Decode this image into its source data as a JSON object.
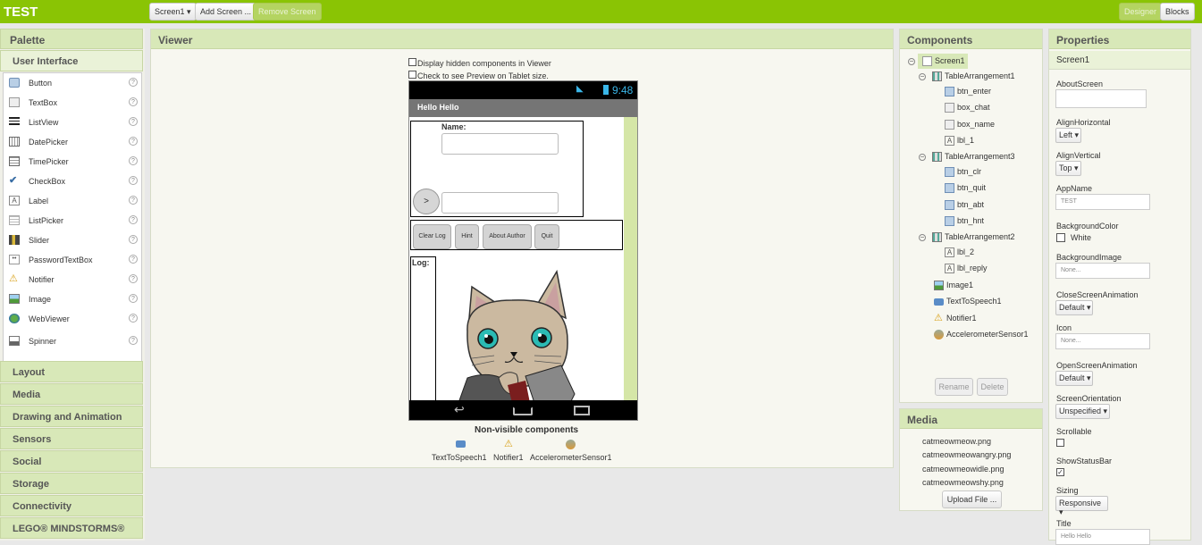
{
  "app": {
    "title": "TEST"
  },
  "toolbar": {
    "screen_select": "Screen1 ▾",
    "add_screen": "Add Screen ...",
    "remove_screen": "Remove Screen",
    "designer": "Designer",
    "blocks": "Blocks"
  },
  "palette": {
    "title": "Palette",
    "category_open": "User Interface",
    "items": [
      {
        "label": "Button",
        "icon": "button-icon"
      },
      {
        "label": "TextBox",
        "icon": "textbox-icon"
      },
      {
        "label": "ListView",
        "icon": "listview-icon"
      },
      {
        "label": "DatePicker",
        "icon": "datepicker-icon"
      },
      {
        "label": "TimePicker",
        "icon": "timepicker-icon"
      },
      {
        "label": "CheckBox",
        "icon": "checkbox-icon"
      },
      {
        "label": "Label",
        "icon": "label-icon"
      },
      {
        "label": "ListPicker",
        "icon": "listpicker-icon"
      },
      {
        "label": "Slider",
        "icon": "slider-icon"
      },
      {
        "label": "PasswordTextBox",
        "icon": "passwordtextbox-icon"
      },
      {
        "label": "Notifier",
        "icon": "notifier-icon"
      },
      {
        "label": "Image",
        "icon": "image-icon"
      },
      {
        "label": "WebViewer",
        "icon": "webviewer-icon"
      },
      {
        "label": "Spinner",
        "icon": "spinner-icon"
      }
    ],
    "categories": [
      "Layout",
      "Media",
      "Drawing and Animation",
      "Sensors",
      "Social",
      "Storage",
      "Connectivity",
      "LEGO® MINDSTORMS®"
    ]
  },
  "viewer": {
    "title": "Viewer",
    "hidden_check": "Display hidden components in Viewer",
    "tablet_check": "Check to see Preview on Tablet size.",
    "phone": {
      "time": "9:48",
      "screen_title": "Hello Hello",
      "name_label": "Name:",
      "enter_button": ">",
      "buttons": [
        "Clear Log",
        "Hint",
        "About Author",
        "Quit"
      ],
      "log_label": "Log:"
    },
    "nonvisible_title": "Non-visible components",
    "nonvisible": [
      "TextToSpeech1",
      "Notifier1",
      "AccelerometerSensor1"
    ]
  },
  "components": {
    "title": "Components",
    "tree": {
      "screen": "Screen1",
      "ta1": "TableArrangement1",
      "ta1_items": [
        "btn_enter",
        "box_chat",
        "box_name",
        "lbl_1"
      ],
      "ta3": "TableArrangement3",
      "ta3_items": [
        "btn_clr",
        "btn_quit",
        "btn_abt",
        "btn_hnt"
      ],
      "ta2": "TableArrangement2",
      "ta2_items": [
        "lbl_2",
        "lbl_reply"
      ],
      "others": [
        "Image1",
        "TextToSpeech1",
        "Notifier1",
        "AccelerometerSensor1"
      ]
    },
    "rename": "Rename",
    "delete": "Delete"
  },
  "media": {
    "title": "Media",
    "files": [
      "catmeowmeow.png",
      "catmeowmeowangry.png",
      "catmeowmeowidle.png",
      "catmeowmeowshy.png"
    ],
    "upload": "Upload File ..."
  },
  "properties": {
    "title": "Properties",
    "component": "Screen1",
    "about_screen": "AboutScreen",
    "align_h": "AlignHorizontal",
    "align_h_value": "Left ▾",
    "align_v": "AlignVertical",
    "align_v_value": "Top ▾",
    "app_name": "AppName",
    "app_name_value": "TEST",
    "bg_color": "BackgroundColor",
    "bg_color_value": "White",
    "bg_image": "BackgroundImage",
    "bg_image_value": "None...",
    "close_anim": "CloseScreenAnimation",
    "close_anim_value": "Default ▾",
    "icon": "Icon",
    "icon_value": "None...",
    "open_anim": "OpenScreenAnimation",
    "open_anim_value": "Default ▾",
    "orientation": "ScreenOrientation",
    "orientation_value": "Unspecified ▾",
    "scrollable": "Scrollable",
    "status_bar": "ShowStatusBar",
    "sizing": "Sizing",
    "sizing_value": "Responsive ▾",
    "title_label": "Title",
    "title_value": "Hello Hello"
  },
  "colors": {
    "accent": "#8ac404",
    "panel_header": "#d8e8b8"
  }
}
